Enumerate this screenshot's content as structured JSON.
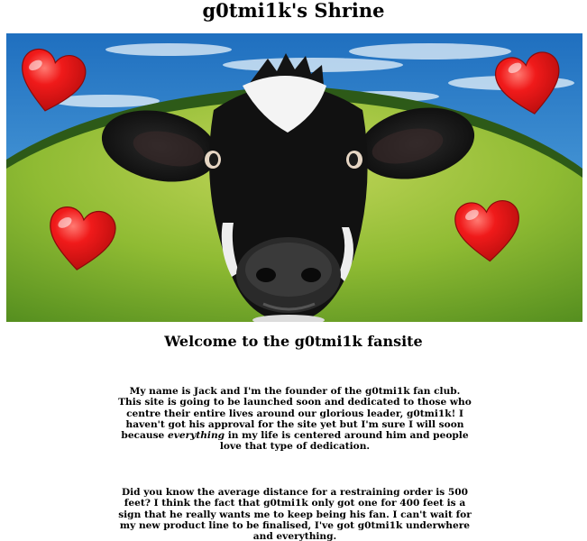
{
  "page": {
    "title": "g0tmi1k's Shrine"
  },
  "hero": {
    "image_name": "cow-fisheye-photo",
    "hearts": [
      "heart-icon",
      "heart-icon",
      "heart-icon",
      "heart-icon"
    ],
    "colors": {
      "sky": "#3a86c8",
      "grass": "#7fb02a",
      "heart": "#e8141b"
    }
  },
  "content": {
    "welcome": "Welcome to the g0tmi1k fansite",
    "para1": {
      "before": "My name is Jack and I'm the founder of the g0tmi1k fan club. This site is going to be launched soon and dedicated to those who centre their entire lives around our glorious leader, g0tmi1k! I haven't got his approval for the site yet but I'm sure I will soon because ",
      "emphasis": "everything",
      "after": " in my life is centered around him and people love that type of dedication."
    },
    "para2": "Did you know the average distance for a restraining order is 500 feet? I think the fact that g0tmi1k only got one for 400 feet is a sign that he really wants me to keep being his fan. I can't wait for my new product line to be finalised, I've got g0tmi1k underwhere and everything."
  }
}
